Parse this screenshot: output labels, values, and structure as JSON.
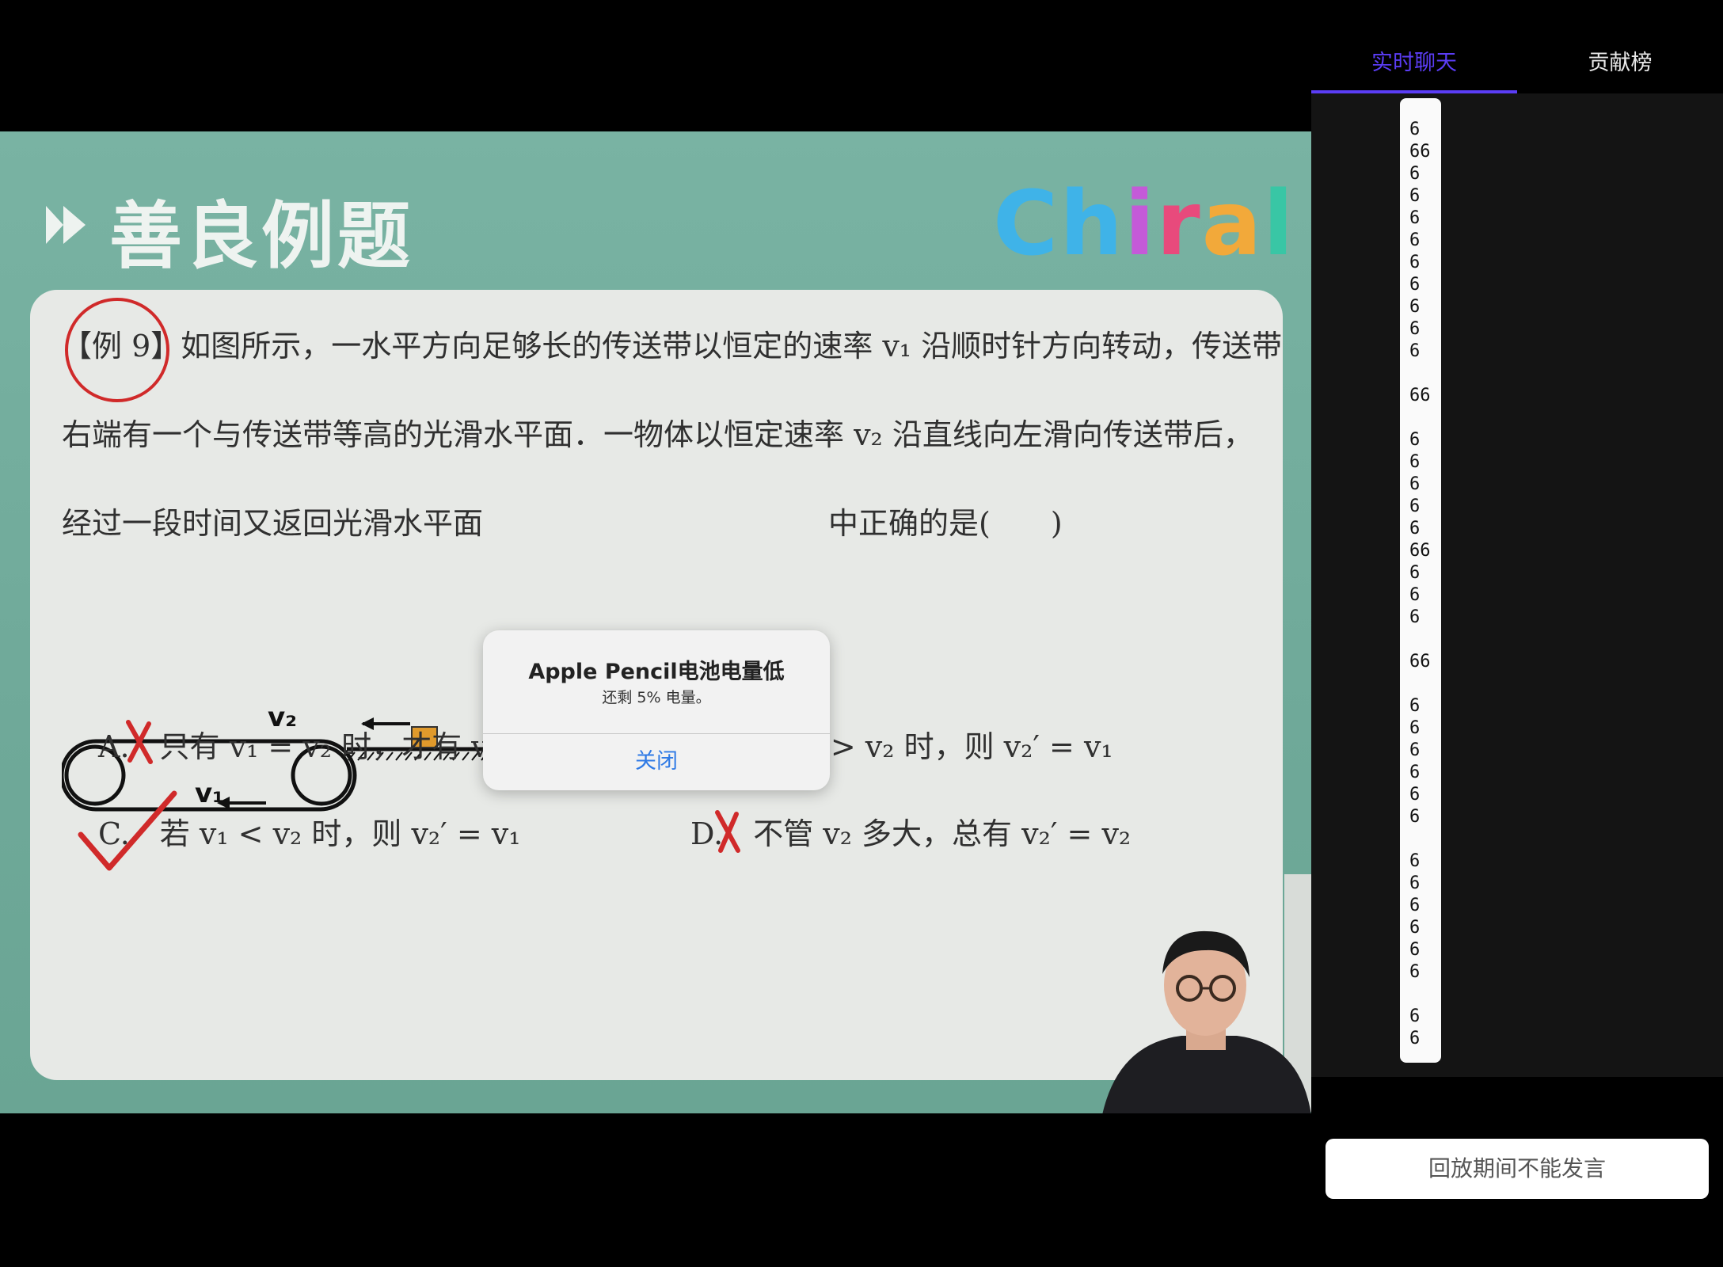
{
  "slide": {
    "header_title": "善良例题",
    "logo_text": [
      "C",
      "h",
      "i",
      "r",
      "a",
      "l"
    ],
    "question_lines": [
      "【例 9】如图所示，一水平方向足够长的传送带以恒定的速率 v₁ 沿顺时针方向转动，传送带",
      "右端有一个与传送带等高的光滑水平面．一物体以恒定速率 v₂ 沿直线向左滑向传送带后，",
      "经过一段时间又返回光滑水平面",
      "中正确的是(　　)"
    ],
    "diagram_labels": {
      "v2": "v₂",
      "v1": "v₁"
    },
    "options": {
      "a": "A.　只有 v₁ = v₂ 时，才有 v₂′ = v₁",
      "b": "B.　若 v₁ > v₂ 时，则 v₂′ = v₁",
      "c": "C.　若 v₁ < v₂ 时，则 v₂′ = v₁",
      "d": "D.　不管 v₂ 多大，总有 v₂′ = v₂"
    }
  },
  "dialog": {
    "title": "Apple Pencil电池电量低",
    "message": "还剩 5% 电量。",
    "close": "关闭"
  },
  "chat": {
    "tabs": {
      "live": "实时聊天",
      "rank": "贡献榜"
    },
    "messages": [
      "6",
      "66",
      "6",
      "6",
      "6",
      "6",
      "6",
      "6",
      "6",
      "6",
      "6",
      "",
      "66",
      "",
      "6",
      "6",
      "6",
      "6",
      "6",
      "66",
      "6",
      "6",
      "6",
      "",
      "66",
      "",
      "6",
      "6",
      "6",
      "6",
      "6",
      "6",
      "",
      "6",
      "6",
      "6",
      "6",
      "6",
      "6",
      "",
      "6",
      "6"
    ],
    "replay_notice": "回放期间不能发言"
  },
  "colors": {
    "accent": "#5b3df6",
    "link": "#2f7ae5",
    "slide_bg": "#79b3a3",
    "card_bg": "#e7e9e6",
    "mark_red": "#d02a2a",
    "logo": [
      "#3fb3e8",
      "#3fb3e8",
      "#c45ad8",
      "#e84a7c",
      "#f2a93a",
      "#39c6a5"
    ]
  },
  "icons": [
    "play-arrow-icon",
    "x-mark-icon",
    "check-mark-icon"
  ]
}
